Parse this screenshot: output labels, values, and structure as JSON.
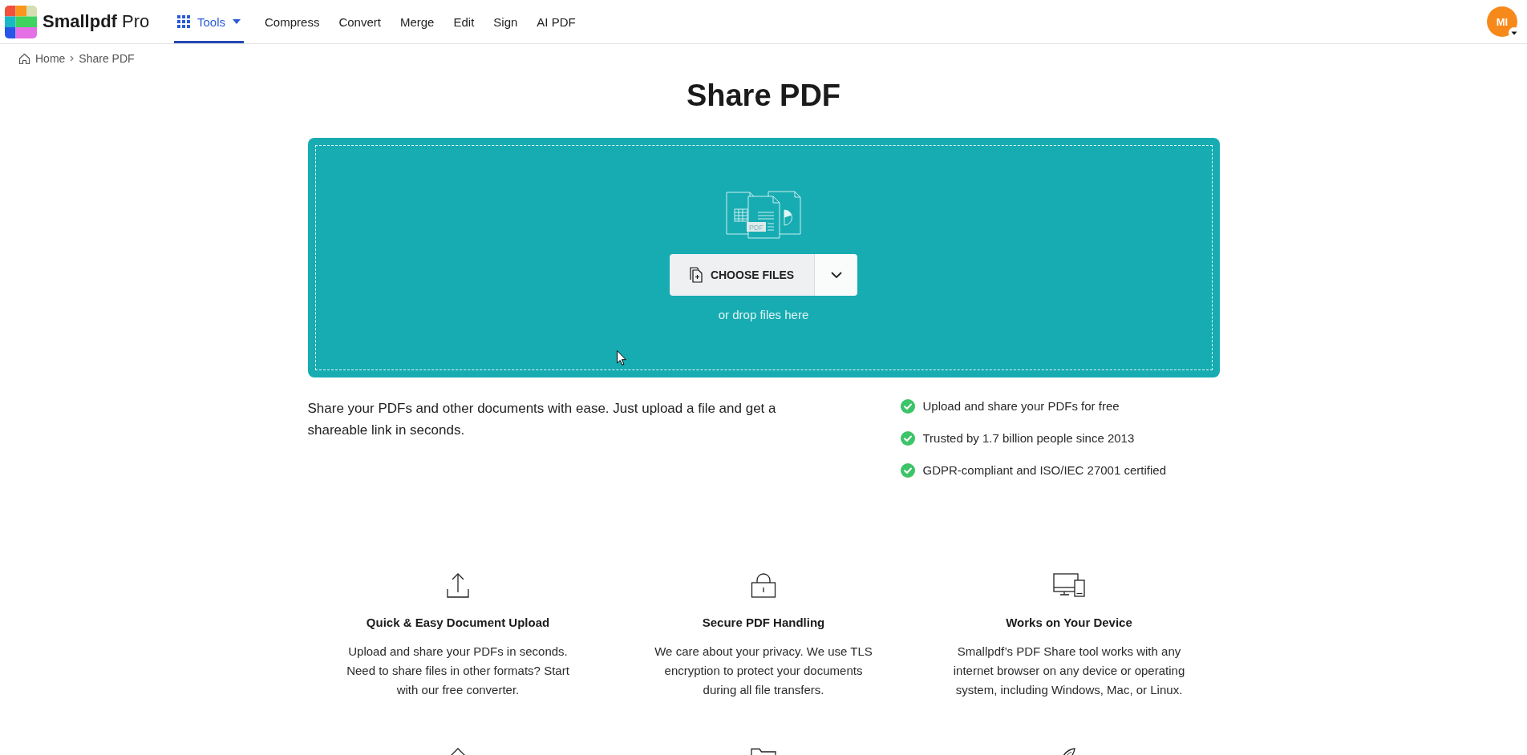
{
  "header": {
    "brand": "**Smallpdf** Pro",
    "nav": [
      {
        "label": "Tools",
        "kind": "menu",
        "selected": true
      },
      {
        "label": "Compress",
        "kind": "link",
        "selected": false
      },
      {
        "label": "Convert",
        "kind": "link",
        "selected": false
      },
      {
        "label": "Merge",
        "kind": "link",
        "selected": false
      },
      {
        "label": "Edit",
        "kind": "link",
        "selected": false
      },
      {
        "label": "Sign",
        "kind": "link",
        "selected": false
      },
      {
        "label": "AI PDF",
        "kind": "link",
        "selected": false
      }
    ],
    "avatar": {
      "initials": "MI"
    }
  },
  "breadcrumb": [
    {
      "label": "Home",
      "kind": "home"
    },
    {
      "label": "Share PDF",
      "kind": "current"
    }
  ],
  "title": "Share PDF",
  "upload": {
    "illustration_label": "PDF",
    "button": "CHOOSE FILES",
    "hint": "or drop files here"
  },
  "description": "Share your PDFs and other documents with ease. Just upload a file and get a shareable link in seconds.",
  "highlights": [
    "Upload and share your PDFs for free",
    "Trusted by 1.7 billion people since 2013",
    "GDPR-compliant and ISO/IEC 27001 certified"
  ],
  "features": [
    {
      "kind": "upload",
      "title": "Quick & Easy Document Upload",
      "text": "Upload and share your PDFs in seconds. Need to share files in other formats? Start with our free converter."
    },
    {
      "kind": "security",
      "title": "Secure PDF Handling",
      "text": "We care about your privacy. We use TLS encryption to protect your documents during all file transfers."
    },
    {
      "kind": "device",
      "title": "Works on Your Device",
      "text": "Smallpdf’s PDF Share tool works with any internet browser on any device or operating system, including Windows, Mac, or Linux."
    }
  ],
  "more_features": [
    {
      "kind": "house"
    },
    {
      "kind": "folder"
    },
    {
      "kind": "rocket"
    }
  ]
}
